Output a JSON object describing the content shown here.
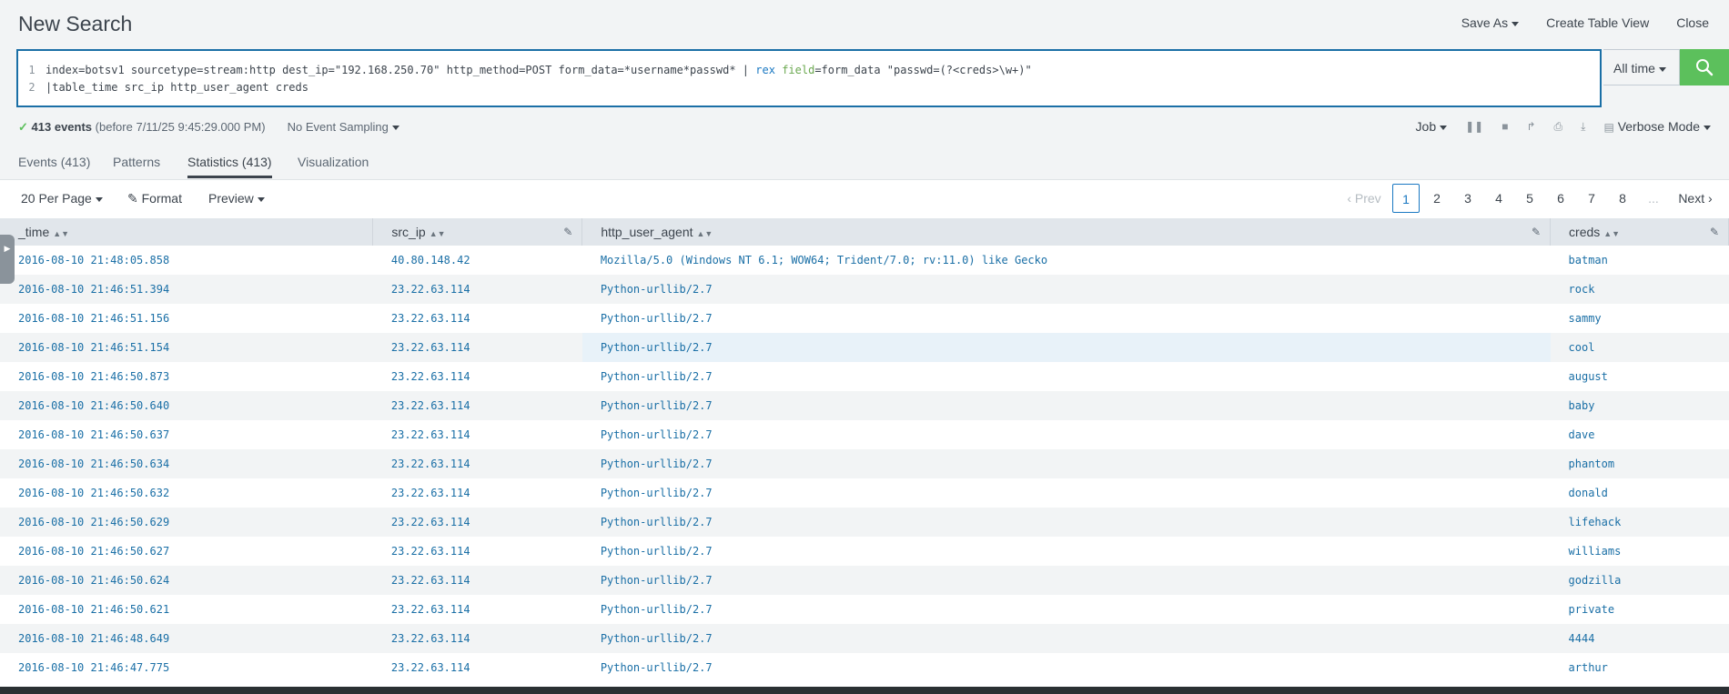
{
  "header": {
    "title": "New Search",
    "save_as": "Save As",
    "create_table_view": "Create Table View",
    "close": "Close"
  },
  "search": {
    "line1_num": "1",
    "line1_a": "index=botsv1 sourcetype=stream:http dest_ip=\"192.168.250.70\" http_method=POST form_data=*username*passwd* | ",
    "line1_kw": "rex",
    "line1_arg": "field",
    "line1_b": "=form_data \"passwd=(?<creds>\\w+)\"",
    "line2_num": "2",
    "line2": "|table_time src_ip http_user_agent creds",
    "time_range": "All time"
  },
  "status": {
    "events": "413 events",
    "before": "(before 7/11/25 9:45:29.000 PM)",
    "sampling": "No Event Sampling",
    "job": "Job",
    "mode": "Verbose Mode"
  },
  "tabs": [
    "Events (413)",
    "Patterns",
    "Statistics (413)",
    "Visualization"
  ],
  "toolbar": {
    "per_page": "20 Per Page",
    "format": "Format",
    "preview": "Preview"
  },
  "pager": {
    "prev": "Prev",
    "pages": [
      "1",
      "2",
      "3",
      "4",
      "5",
      "6",
      "7",
      "8"
    ],
    "ellipsis": "...",
    "next": "Next"
  },
  "table": {
    "columns": [
      "_time",
      "src_ip",
      "http_user_agent",
      "creds"
    ],
    "rows": [
      [
        "2016-08-10 21:48:05.858",
        "40.80.148.42",
        "Mozilla/5.0 (Windows NT 6.1; WOW64; Trident/7.0; rv:11.0) like Gecko",
        "batman"
      ],
      [
        "2016-08-10 21:46:51.394",
        "23.22.63.114",
        "Python-urllib/2.7",
        "rock"
      ],
      [
        "2016-08-10 21:46:51.156",
        "23.22.63.114",
        "Python-urllib/2.7",
        "sammy"
      ],
      [
        "2016-08-10 21:46:51.154",
        "23.22.63.114",
        "Python-urllib/2.7",
        "cool"
      ],
      [
        "2016-08-10 21:46:50.873",
        "23.22.63.114",
        "Python-urllib/2.7",
        "august"
      ],
      [
        "2016-08-10 21:46:50.640",
        "23.22.63.114",
        "Python-urllib/2.7",
        "baby"
      ],
      [
        "2016-08-10 21:46:50.637",
        "23.22.63.114",
        "Python-urllib/2.7",
        "dave"
      ],
      [
        "2016-08-10 21:46:50.634",
        "23.22.63.114",
        "Python-urllib/2.7",
        "phantom"
      ],
      [
        "2016-08-10 21:46:50.632",
        "23.22.63.114",
        "Python-urllib/2.7",
        "donald"
      ],
      [
        "2016-08-10 21:46:50.629",
        "23.22.63.114",
        "Python-urllib/2.7",
        "lifehack"
      ],
      [
        "2016-08-10 21:46:50.627",
        "23.22.63.114",
        "Python-urllib/2.7",
        "williams"
      ],
      [
        "2016-08-10 21:46:50.624",
        "23.22.63.114",
        "Python-urllib/2.7",
        "godzilla"
      ],
      [
        "2016-08-10 21:46:50.621",
        "23.22.63.114",
        "Python-urllib/2.7",
        "private"
      ],
      [
        "2016-08-10 21:46:48.649",
        "23.22.63.114",
        "Python-urllib/2.7",
        "4444"
      ],
      [
        "2016-08-10 21:46:47.775",
        "23.22.63.114",
        "Python-urllib/2.7",
        "arthur"
      ]
    ]
  },
  "colors": {
    "accent": "#1a78c2",
    "search_button": "#5cc05c"
  }
}
